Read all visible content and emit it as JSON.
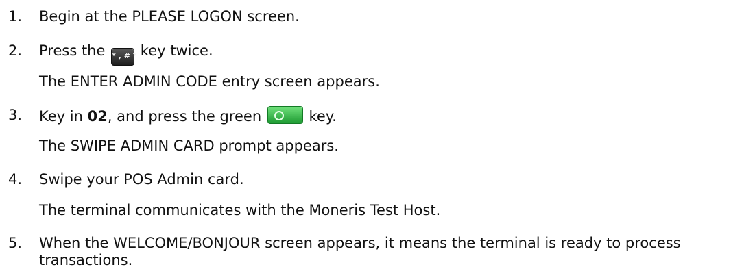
{
  "steps": [
    {
      "number": "1.",
      "text": "Begin at the PLEASE LOGON screen."
    },
    {
      "number": "2.",
      "before": "Press the",
      "key_label": "* , # *",
      "after": "key twice."
    },
    {
      "sub": "The ENTER ADMIN CODE entry screen appears."
    },
    {
      "number": "3.",
      "before": "Key in",
      "bold": "02",
      "middle": ", and press the green",
      "after": "key."
    },
    {
      "sub": "The SWIPE ADMIN CARD prompt appears."
    },
    {
      "number": "4.",
      "text": "Swipe your POS Admin card."
    },
    {
      "sub": "The terminal communicates with the Moneris Test Host."
    },
    {
      "number": "5.",
      "text": "When the WELCOME/BONJOUR screen appears, it means the terminal is ready to process",
      "text2": "transactions."
    }
  ],
  "icons": {
    "hash_key": "hash-key-icon",
    "green_key": "green-key-icon"
  }
}
